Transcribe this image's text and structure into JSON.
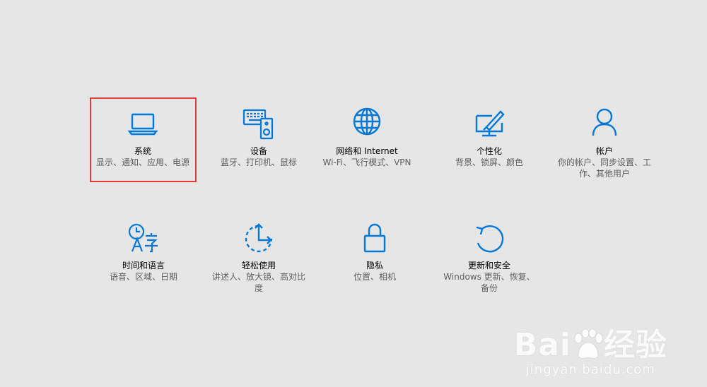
{
  "accent_color": "#0078d7",
  "selection_color": "#e03c3c",
  "tiles": [
    {
      "icon": "laptop-icon",
      "title": "系统",
      "desc": "显示、通知、应用、电源"
    },
    {
      "icon": "keyboard-speaker-icon",
      "title": "设备",
      "desc": "蓝牙、打印机、鼠标"
    },
    {
      "icon": "globe-icon",
      "title": "网络和 Internet",
      "desc": "Wi-Fi、飞行模式、VPN"
    },
    {
      "icon": "personalize-icon",
      "title": "个性化",
      "desc": "背景、锁屏、颜色"
    },
    {
      "icon": "person-icon",
      "title": "帐户",
      "desc": "你的帐户、同步设置、工作、其他用户"
    },
    {
      "icon": "time-language-icon",
      "title": "时间和语言",
      "desc": "语音、区域、日期"
    },
    {
      "icon": "ease-of-access-icon",
      "title": "轻松使用",
      "desc": "讲述人、放大镜、高对比度"
    },
    {
      "icon": "lock-icon",
      "title": "隐私",
      "desc": "位置、相机"
    },
    {
      "icon": "update-icon",
      "title": "更新和安全",
      "desc": "Windows 更新、恢复、备份"
    }
  ],
  "watermark": {
    "logo_text_left": "Bai",
    "logo_text_right": "经验",
    "url": "jingyan.baidu.com"
  }
}
